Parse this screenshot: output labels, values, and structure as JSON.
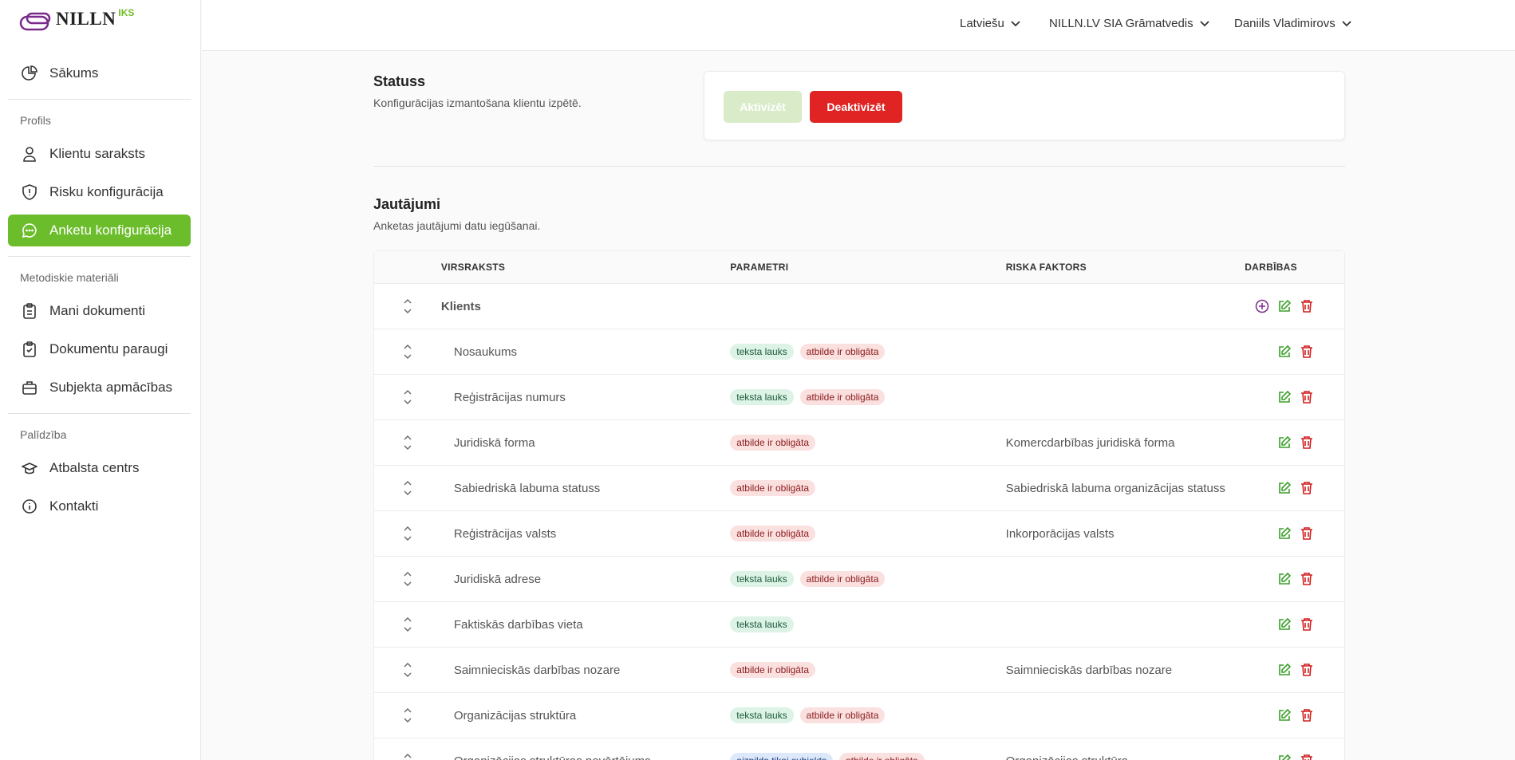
{
  "logo": {
    "word": "NILLN",
    "sup": "IKS"
  },
  "sidebar": {
    "home": "Sākums",
    "section_profile": "Profils",
    "profile_items": [
      "Klientu saraksts",
      "Risku konfigurācija",
      "Anketu konfigurācija"
    ],
    "section_method": "Metodiskie materiāli",
    "method_items": [
      "Mani dokumenti",
      "Dokumentu paraugi",
      "Subjekta apmācības"
    ],
    "section_help": "Palīdzība",
    "help_items": [
      "Atbalsta centrs",
      "Kontakti"
    ]
  },
  "topbar": {
    "language": "Latviešu",
    "company": "NILLN.LV SIA Grāmatvedis",
    "user": "Daniils Vladimirovs"
  },
  "status": {
    "title": "Statuss",
    "desc": "Konfigurācijas izmantošana klientu izpētē.",
    "activate": "Aktivizēt",
    "deactivate": "Deaktivizēt"
  },
  "questions": {
    "title": "Jautājumi",
    "desc": "Anketas jautājumi datu iegūšanai.",
    "columns": {
      "title": "VIRSRAKSTS",
      "params": "PARAMETRI",
      "risk": "RISKA FAKTORS",
      "actions": "DARBĪBAS"
    },
    "tags": {
      "text": "teksta lauks",
      "required": "atbilde ir obligāta",
      "subject": "aizpilda tikai subjekts"
    },
    "rows": [
      {
        "title": "Klients",
        "parent": true,
        "tags": [],
        "risk": ""
      },
      {
        "title": "Nosaukums",
        "tags": [
          "text",
          "required"
        ],
        "risk": ""
      },
      {
        "title": "Reģistrācijas numurs",
        "tags": [
          "text",
          "required"
        ],
        "risk": ""
      },
      {
        "title": "Juridiskā forma",
        "tags": [
          "required"
        ],
        "risk": "Komercdarbības juridiskā forma"
      },
      {
        "title": "Sabiedriskā labuma statuss",
        "tags": [
          "required"
        ],
        "risk": "Sabiedriskā labuma organizācijas statuss"
      },
      {
        "title": "Reģistrācijas valsts",
        "tags": [
          "required"
        ],
        "risk": "Inkorporācijas valsts"
      },
      {
        "title": "Juridiskā adrese",
        "tags": [
          "text",
          "required"
        ],
        "risk": ""
      },
      {
        "title": "Faktiskās darbības vieta",
        "tags": [
          "text"
        ],
        "risk": ""
      },
      {
        "title": "Saimnieciskās darbības nozare",
        "tags": [
          "required"
        ],
        "risk": "Saimnieciskās darbības nozare"
      },
      {
        "title": "Organizācijas struktūra",
        "tags": [
          "text",
          "required"
        ],
        "risk": ""
      },
      {
        "title": "Organizācijas struktūras novērtējums",
        "tags": [
          "subject",
          "required"
        ],
        "risk": "Organizācijas struktūra"
      }
    ]
  },
  "colors": {
    "accent": "#6cbd2c",
    "danger": "#e02424",
    "purple": "#7a2a8c"
  }
}
